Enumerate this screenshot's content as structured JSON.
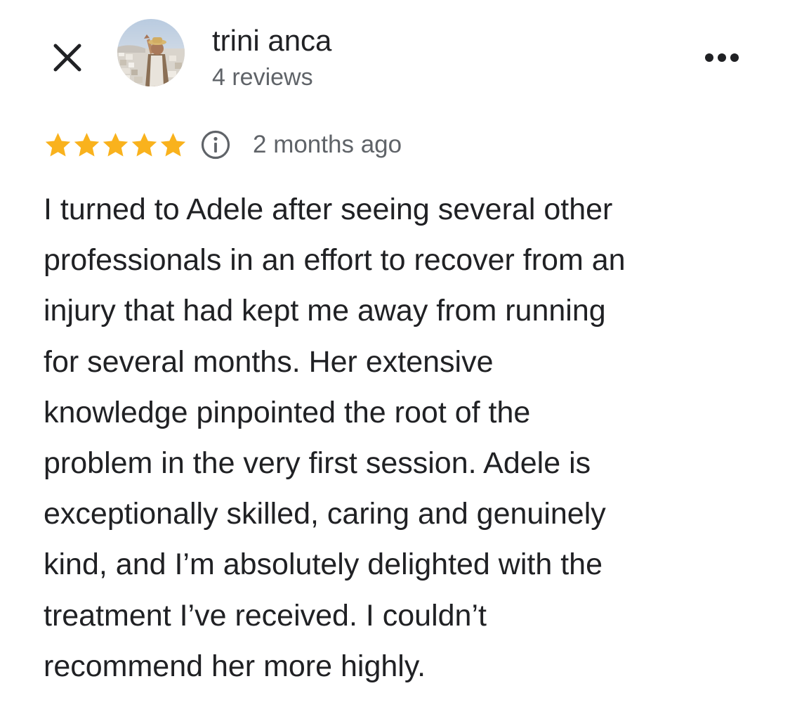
{
  "header": {
    "close_icon": "close-icon",
    "more_icon": "more-horizontal-icon"
  },
  "reviewer": {
    "name": "trini anca",
    "review_count": "4 reviews",
    "avatar_description_icon": "avatar-photo"
  },
  "rating": {
    "stars": 5,
    "max_stars": 5,
    "star_color": "#F9B21D",
    "info_icon": "info-icon",
    "timestamp": "2 months ago"
  },
  "review": {
    "lines": [
      "I turned to Adele after seeing several other",
      "professionals in an effort to recover from an",
      "injury that had kept me away from running",
      "for several months. Her extensive",
      "knowledge pinpointed the root of the",
      "problem in the very first session. Adele is",
      "exceptionally skilled, caring and genuinely",
      "kind, and I’m absolutely delighted with the",
      "treatment I’ve received. I couldn’t",
      "recommend her more highly."
    ]
  },
  "colors": {
    "text_primary": "#202124",
    "text_secondary": "#5f6368",
    "star": "#F9B21D"
  }
}
